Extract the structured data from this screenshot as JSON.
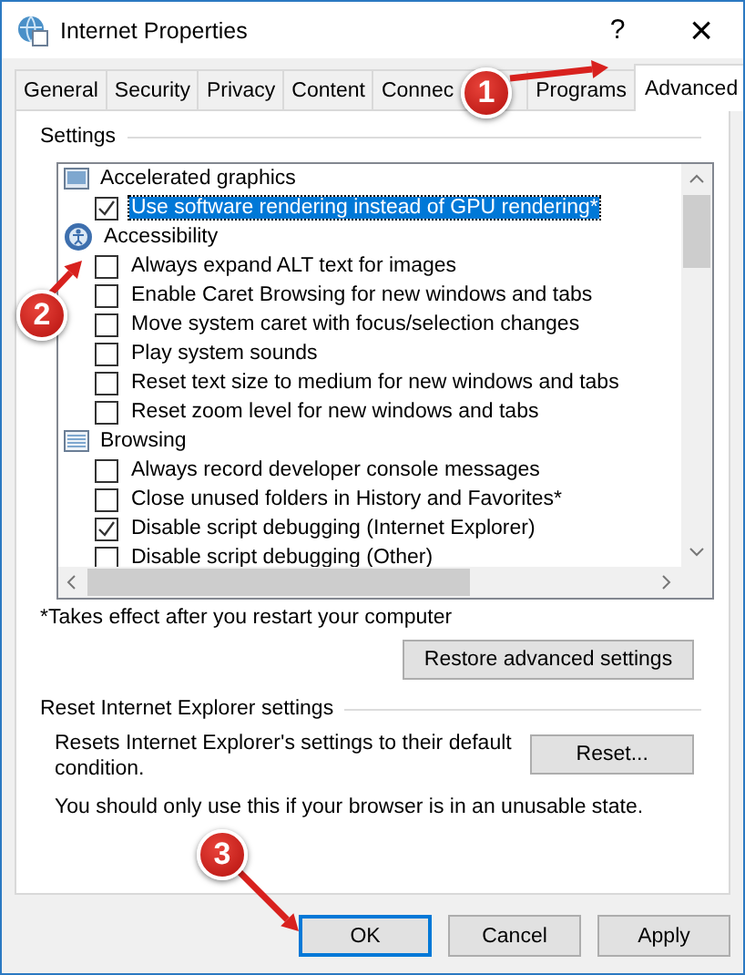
{
  "window": {
    "title": "Internet Properties",
    "help": "?",
    "close": "×"
  },
  "tabs": [
    {
      "label": "General",
      "selected": false
    },
    {
      "label": "Security",
      "selected": false
    },
    {
      "label": "Privacy",
      "selected": false
    },
    {
      "label": "Content",
      "selected": false
    },
    {
      "label": "Connec",
      "selected": false
    },
    {
      "label": "Programs",
      "selected": false
    },
    {
      "label": "Advanced",
      "selected": true
    }
  ],
  "settings": {
    "heading": "Settings",
    "items": [
      {
        "kind": "group",
        "label": "Accelerated graphics",
        "children": [
          {
            "label": "Use software rendering instead of GPU rendering*",
            "checked": true,
            "selected": true
          }
        ]
      },
      {
        "kind": "group",
        "label": "Accessibility",
        "children": [
          {
            "label": "Always expand ALT text for images",
            "checked": false,
            "selected": false
          },
          {
            "label": "Enable Caret Browsing for new windows and tabs",
            "checked": false,
            "selected": false
          },
          {
            "label": "Move system caret with focus/selection changes",
            "checked": false,
            "selected": false
          },
          {
            "label": "Play system sounds",
            "checked": false,
            "selected": false
          },
          {
            "label": "Reset text size to medium for new windows and tabs",
            "checked": false,
            "selected": false
          },
          {
            "label": "Reset zoom level for new windows and tabs",
            "checked": false,
            "selected": false
          }
        ]
      },
      {
        "kind": "group",
        "label": "Browsing",
        "children": [
          {
            "label": "Always record developer console messages",
            "checked": false,
            "selected": false
          },
          {
            "label": "Close unused folders in History and Favorites*",
            "checked": false,
            "selected": false
          },
          {
            "label": "Disable script debugging (Internet Explorer)",
            "checked": true,
            "selected": false
          },
          {
            "label": "Disable script debugging (Other)",
            "checked": false,
            "selected": false
          }
        ]
      }
    ],
    "note": "*Takes effect after you restart your computer",
    "restore_button": "Restore advanced settings"
  },
  "reset": {
    "heading": "Reset Internet Explorer settings",
    "description": "Resets Internet Explorer's settings to their default condition.",
    "button": "Reset...",
    "warning": "You should only use this if your browser is in an unusable state."
  },
  "buttons": [
    {
      "label": "OK",
      "selected": true
    },
    {
      "label": "Cancel",
      "selected": false
    },
    {
      "label": "Apply",
      "selected": false
    }
  ],
  "annotations": [
    {
      "label": "1"
    },
    {
      "label": "2"
    },
    {
      "label": "3"
    }
  ]
}
